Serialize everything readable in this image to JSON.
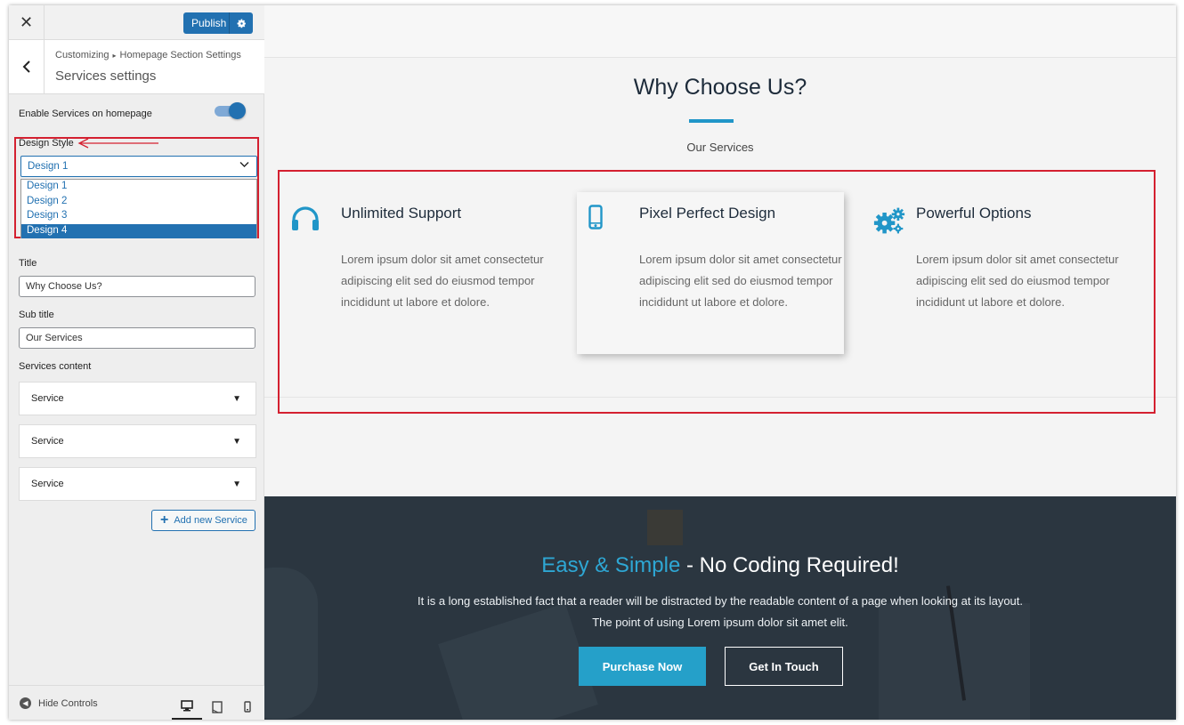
{
  "sidebar": {
    "close_label": "✕",
    "publish_label": "Publish",
    "breadcrumb": {
      "root": "Customizing",
      "section": "Homepage Section Settings"
    },
    "section_title": "Services settings",
    "enable_label": "Enable Services on homepage",
    "enable_toggle_on": true,
    "design_style_label": "Design Style",
    "design_select": {
      "value": "Design 1",
      "options": [
        "Design 1",
        "Design 2",
        "Design 3",
        "Design 4"
      ],
      "highlighted_option": "Design 4"
    },
    "title_label": "Title",
    "title_value": "Why Choose Us?",
    "subtitle_label": "Sub title",
    "subtitle_value": "Our Services",
    "services_content_label": "Services content",
    "service_items": [
      "Service",
      "Service",
      "Service"
    ],
    "add_service_label": "Add new Service",
    "hide_controls_label": "Hide Controls",
    "devices": [
      "desktop-icon",
      "tablet-icon",
      "mobile-icon"
    ],
    "active_device": "desktop"
  },
  "preview": {
    "heading": "Why Choose Us?",
    "subheading": "Our Services",
    "services": [
      {
        "icon": "headphones-icon",
        "title": "Unlimited Support",
        "text": "Lorem ipsum dolor sit amet consectetur adipiscing elit sed do eiusmod tempor incididunt ut labore et dolore."
      },
      {
        "icon": "mobile-phone-icon",
        "title": "Pixel Perfect Design",
        "text": "Lorem ipsum dolor sit amet consectetur adipiscing elit sed do eiusmod tempor incididunt ut labore et dolore."
      },
      {
        "icon": "gears-icon",
        "title": "Powerful Options",
        "text": "Lorem ipsum dolor sit amet consectetur adipiscing elit sed do eiusmod tempor incididunt ut labore et dolore."
      }
    ],
    "cta": {
      "title_accent": "Easy & Simple",
      "title_rest": " - No Coding Required!",
      "description": "It is a long established fact that a reader will be distracted by the readable content of a page when looking at its layout. The point of using Lorem ipsum dolor sit amet elit.",
      "primary_button": "Purchase Now",
      "secondary_button": "Get In Touch"
    }
  },
  "colors": {
    "accent": "#2196c8",
    "wp_blue": "#2271b1",
    "annotation_red": "#d42030",
    "dark_band": "#2b3640"
  }
}
